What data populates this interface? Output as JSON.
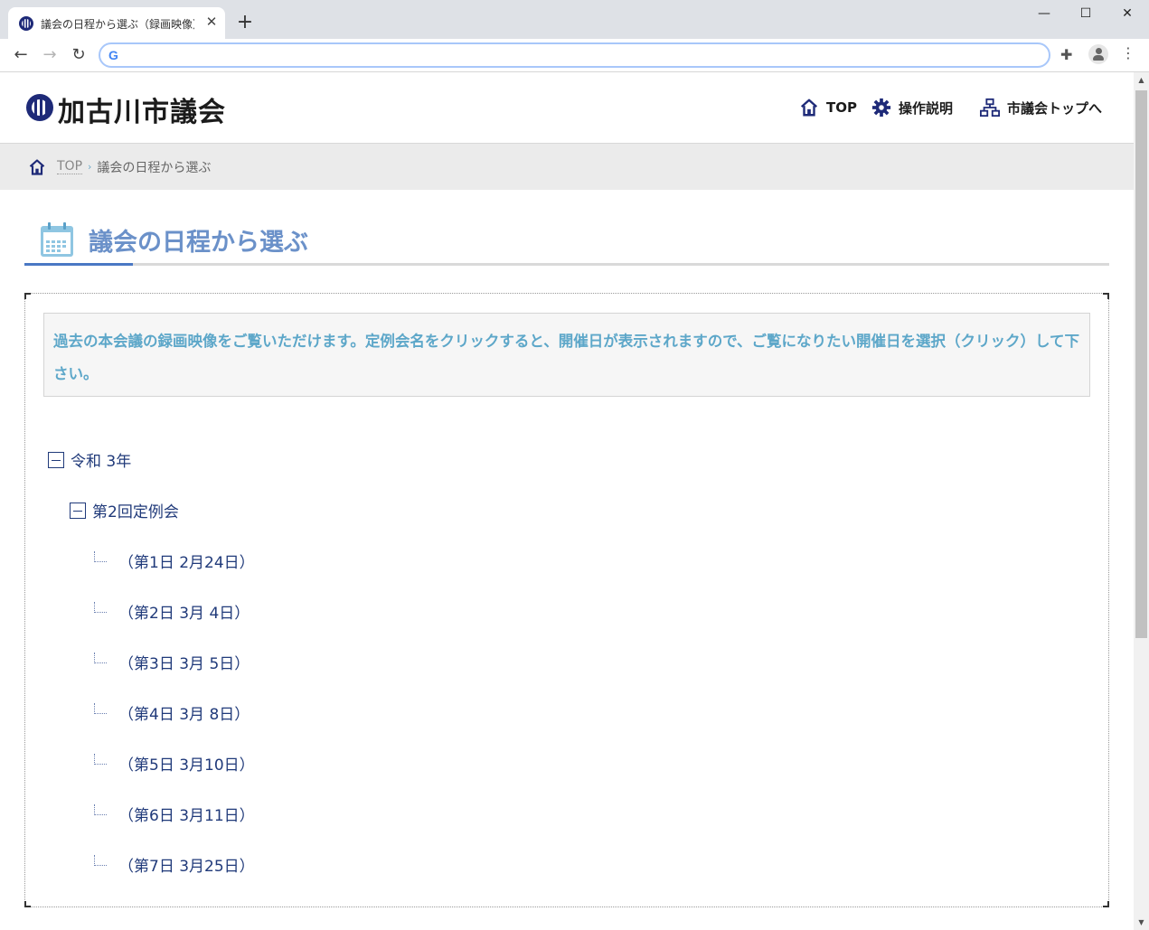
{
  "browser": {
    "tab_title": "議会の日程から選ぶ（録画映像）",
    "tab_close": "✕",
    "new_tab": "+",
    "address": "",
    "window_controls": {
      "minimize": "—",
      "maximize": "☐",
      "close": "✕"
    }
  },
  "site": {
    "logo_text": "加古川市議会",
    "nav": {
      "top": "TOP",
      "help": "操作説明",
      "council_top": "市議会トップへ"
    }
  },
  "breadcrumb": {
    "home_label": "TOP",
    "separator": "›",
    "current": "議会の日程から選ぶ"
  },
  "page": {
    "title": "議会の日程から選ぶ",
    "notice": "過去の本会議の録画映像をご覧いただけます。定例会名をクリックすると、開催日が表示されますので、ご覧になりたい開催日を選択（クリック）して下さい。"
  },
  "tree": {
    "year": "令和 3年",
    "session": "第2回定例会",
    "days": [
      "（第1日 2月24日）",
      "（第2日 3月 4日）",
      "（第3日 3月 5日）",
      "（第4日 3月 8日）",
      "（第5日 3月10日）",
      "（第6日 3月11日）",
      "（第7日 3月25日）"
    ]
  },
  "colors": {
    "brand_navy": "#1e2a78",
    "title_blue": "#6b91c9",
    "notice_text": "#5da7c9",
    "tree_text": "#203a7a",
    "accent": "#4a78c4"
  }
}
